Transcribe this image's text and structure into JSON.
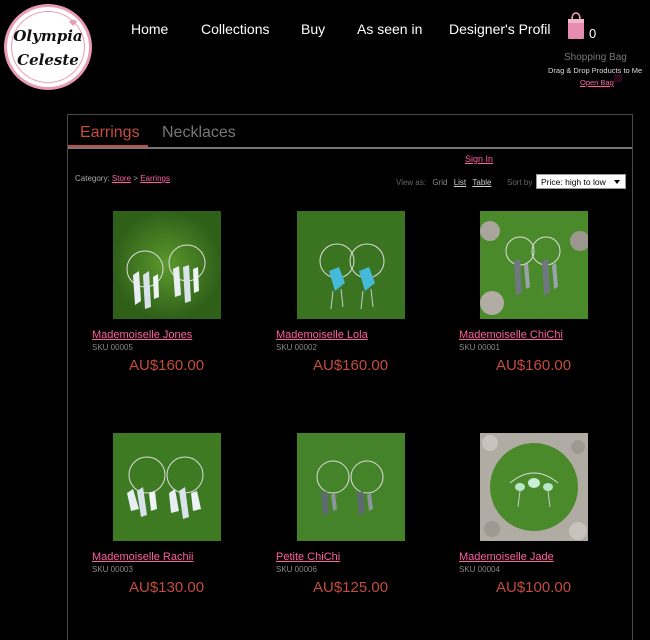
{
  "brand": {
    "logo_line1": "Olympia",
    "logo_line2": "Celeste",
    "pink": "#e79bb6"
  },
  "nav": {
    "items": [
      {
        "label": "Home"
      },
      {
        "label": "Collections"
      },
      {
        "label": "Buy"
      },
      {
        "label": "As seen in"
      },
      {
        "label": "Designer's Profil"
      }
    ]
  },
  "bag": {
    "icon": "shopping-bag-icon",
    "count": "0",
    "title": "Shopping Bag",
    "hint": "Drag & Drop Products to Me",
    "open_label": "Open Bag"
  },
  "tabs": {
    "active": "Earrings",
    "inactive": "Necklaces"
  },
  "account": {
    "signin_label": "Sign In"
  },
  "toolbar": {
    "category_label": "Category:",
    "breadcrumb_store": "Store",
    "breadcrumb_sep": ">",
    "breadcrumb_current": "Earrings",
    "viewas_label": "View as:",
    "view_grid": "Grid",
    "view_list": "List",
    "view_table": "Table",
    "sortby_label": "Sort by",
    "sort_value": "Price: high to low"
  },
  "colors": {
    "accent_red": "#c44b3f",
    "link_pink": "#ff5fa2",
    "background": "#000000"
  },
  "products": [
    {
      "name": "Mademoiselle Jones",
      "sku": "SKU 00005",
      "price": "AU$160.00",
      "image": "clear-crystal-hoop-earrings-on-grass"
    },
    {
      "name": "Mademoiselle Lola",
      "sku": "SKU 00002",
      "price": "AU$160.00",
      "image": "blue-crystal-hoop-earrings-on-grass"
    },
    {
      "name": "Mademoiselle ChiChi",
      "sku": "SKU 00001",
      "price": "AU$160.00",
      "image": "smoky-crystal-earrings-on-grass"
    },
    {
      "name": "Mademoiselle Rachii",
      "sku": "SKU 00003",
      "price": "AU$130.00",
      "image": "clear-crystal-cluster-earrings-on-grass"
    },
    {
      "name": "Petite ChiChi",
      "sku": "SKU 00006",
      "price": "AU$125.00",
      "image": "small-smoky-crystal-earrings-on-grass"
    },
    {
      "name": "Mademoiselle Jade",
      "sku": "SKU 00004",
      "price": "AU$100.00",
      "image": "jade-stone-earrings-on-grass-and-pebbles"
    }
  ]
}
